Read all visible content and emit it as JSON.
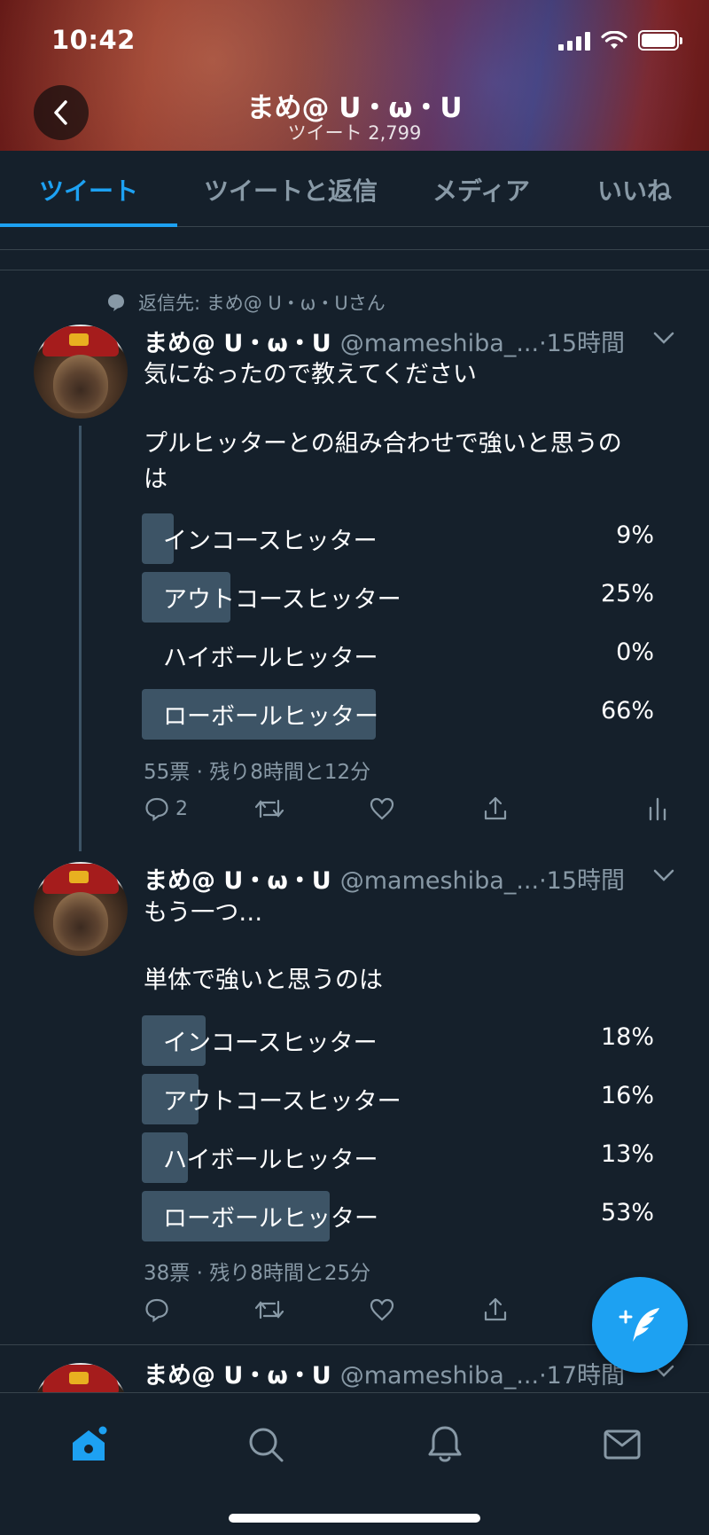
{
  "status_bar": {
    "time": "10:42"
  },
  "header": {
    "title": "まめ@ U・ω・U",
    "subtitle": "ツイート 2,799"
  },
  "tabs": [
    {
      "label": "ツイート",
      "active": true
    },
    {
      "label": "ツイートと返信",
      "active": false
    },
    {
      "label": "メディア",
      "active": false
    },
    {
      "label": "いいね",
      "active": false
    }
  ],
  "tweets": [
    {
      "reply_to": "返信先: まめ@ U・ω・Uさん",
      "name": "まめ@ U・ω・U",
      "handle": "@mameshiba_...",
      "time": "·15時間",
      "text_lines": [
        "気になったので教えてください",
        "",
        "プルヒッターとの組み合わせで強いと思うの",
        "は"
      ],
      "poll": [
        {
          "label": "インコースヒッター",
          "percent": "9%",
          "value": 9
        },
        {
          "label": "アウトコースヒッター",
          "percent": "25%",
          "value": 25
        },
        {
          "label": "ハイボールヒッター",
          "percent": "0%",
          "value": 0
        },
        {
          "label": "ローボールヒッター",
          "percent": "66%",
          "value": 66
        }
      ],
      "poll_meta": "55票 · 残り8時間と12分",
      "reply_count": "2"
    },
    {
      "name": "まめ@ U・ω・U",
      "handle": "@mameshiba_...",
      "time": "·15時間",
      "text_lines": [
        "もう一つ…",
        "",
        "単体で強いと思うのは"
      ],
      "poll": [
        {
          "label": "インコースヒッター",
          "percent": "18%",
          "value": 18
        },
        {
          "label": "アウトコースヒッター",
          "percent": "16%",
          "value": 16
        },
        {
          "label": "ハイボールヒッター",
          "percent": "13%",
          "value": 13
        },
        {
          "label": "ローボールヒッター",
          "percent": "53%",
          "value": 53
        }
      ],
      "poll_meta": "38票 · 残り8時間と25分",
      "reply_count": ""
    },
    {
      "name": "まめ@ U・ω・U",
      "handle": "@mameshiba_...",
      "time": "·17時間"
    }
  ],
  "colors": {
    "accent": "#1da1f2",
    "background": "#15202b",
    "muted": "#8899a6",
    "poll_bar": "#3d5466"
  },
  "icons": {
    "back": "chevron-left-icon",
    "reply": "reply-icon",
    "retweet": "retweet-icon",
    "like": "heart-icon",
    "share": "share-icon",
    "analytics": "analytics-icon",
    "compose": "compose-tweet-icon",
    "nav": [
      "home-icon",
      "search-icon",
      "notifications-icon",
      "messages-icon"
    ]
  }
}
